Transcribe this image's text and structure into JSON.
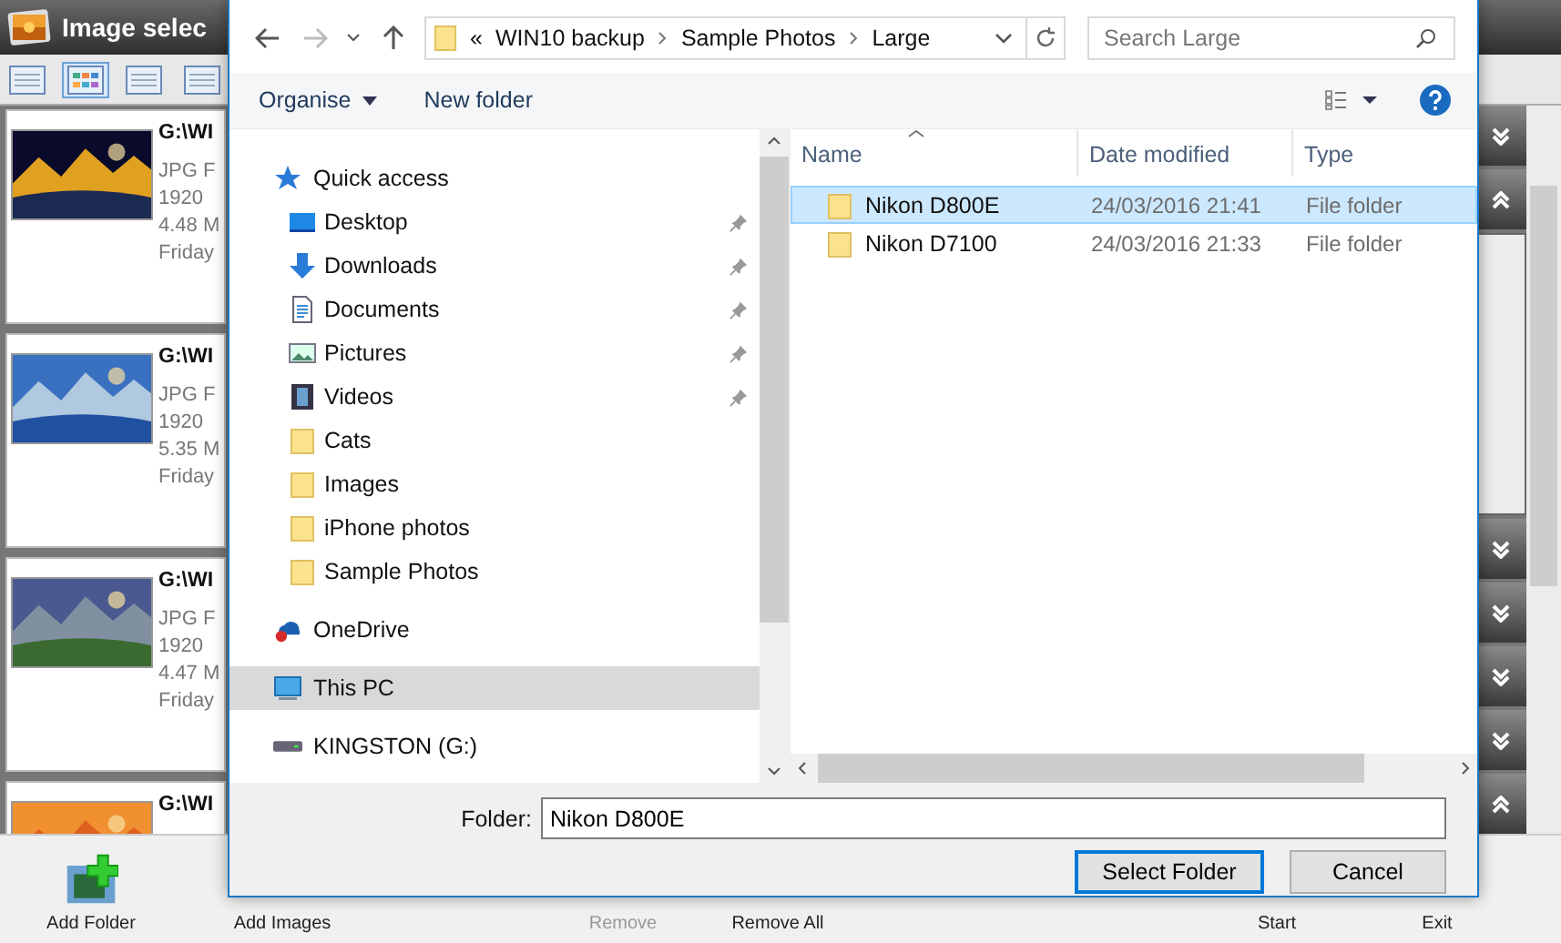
{
  "app": {
    "title": "Image selec",
    "view_buttons": [
      {
        "selected": false
      },
      {
        "selected": true
      },
      {
        "selected": false
      },
      {
        "selected": false
      }
    ],
    "images": [
      {
        "path": "G:\\WI",
        "lines": [
          "JPG F",
          "1920",
          "4.48 M",
          "Friday"
        ]
      },
      {
        "path": "G:\\WI",
        "lines": [
          "JPG F",
          "1920",
          "5.35 M",
          "Friday"
        ]
      },
      {
        "path": "G:\\WI",
        "lines": [
          "JPG F",
          "1920",
          "4.47 M",
          "Friday"
        ]
      },
      {
        "path": "G:\\WI"
      }
    ],
    "side_buttons_top": [
      {
        "kind": "down"
      },
      {
        "kind": "up"
      }
    ],
    "side_buttons_bottom": [
      {
        "kind": "down"
      },
      {
        "kind": "down"
      },
      {
        "kind": "down"
      },
      {
        "kind": "down"
      },
      {
        "kind": "up"
      }
    ],
    "toolbar": [
      {
        "label": "Add Folder",
        "disabled": false
      },
      {
        "label": "Add Images",
        "disabled": false
      },
      {
        "label": "Remove",
        "disabled": true
      },
      {
        "label": "Remove All",
        "disabled": false
      },
      {
        "label": "Start",
        "disabled": false
      },
      {
        "label": "Exit",
        "disabled": false
      }
    ]
  },
  "dialog": {
    "address": {
      "prefix": "«",
      "crumbs": [
        "WIN10 backup",
        "Sample Photos",
        "Large"
      ]
    },
    "search": {
      "placeholder": "Search Large"
    },
    "commands": {
      "organise": "Organise",
      "new_folder": "New folder"
    },
    "nav": [
      {
        "label": "Quick access",
        "kind": "star",
        "selected": false,
        "pinned": false,
        "children": [
          {
            "label": "Desktop",
            "kind": "desktop",
            "selected": false,
            "pinned": true
          },
          {
            "label": "Downloads",
            "kind": "download",
            "selected": false,
            "pinned": true
          },
          {
            "label": "Documents",
            "kind": "document",
            "selected": false,
            "pinned": true
          },
          {
            "label": "Pictures",
            "kind": "pictures",
            "selected": false,
            "pinned": true
          },
          {
            "label": "Videos",
            "kind": "video",
            "selected": false,
            "pinned": true
          },
          {
            "label": "Cats",
            "kind": "folder",
            "selected": false,
            "pinned": false
          },
          {
            "label": "Images",
            "kind": "folder",
            "selected": false,
            "pinned": false
          },
          {
            "label": "iPhone photos",
            "kind": "folder",
            "selected": false,
            "pinned": false
          },
          {
            "label": "Sample Photos",
            "kind": "folder",
            "selected": false,
            "pinned": false
          }
        ]
      },
      {
        "label": "OneDrive",
        "kind": "cloud",
        "selected": false,
        "pinned": false
      },
      {
        "label": "This PC",
        "kind": "pc",
        "selected": true,
        "pinned": false
      },
      {
        "label": "KINGSTON (G:)",
        "kind": "drive",
        "selected": false,
        "pinned": false
      }
    ],
    "columns": [
      "Name",
      "Date modified",
      "Type"
    ],
    "files": [
      {
        "name": "Nikon D800E",
        "date": "24/03/2016 21:41",
        "type": "File folder",
        "selected": true
      },
      {
        "name": "Nikon D7100",
        "date": "24/03/2016 21:33",
        "type": "File folder",
        "selected": false
      }
    ],
    "folder": {
      "label": "Folder:",
      "value": "Nikon D800E"
    },
    "buttons": {
      "ok": "Select Folder",
      "cancel": "Cancel"
    }
  }
}
